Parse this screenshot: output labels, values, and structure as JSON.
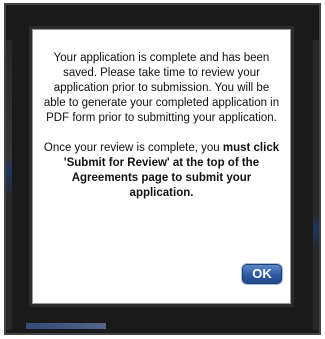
{
  "dialog": {
    "paragraph1": "Your application is complete and has been saved. Please take time to review your application prior to submission. You will be able to generate your completed application in PDF form prior to submitting your application.",
    "paragraph2_intro": "Once your review is complete, you",
    "paragraph2_bold": "must click 'Submit for Review' at the top of the Agreements page to submit your application.",
    "ok_label": "OK"
  },
  "colors": {
    "frame": "#1a1a1a",
    "button": "#2c5aa3"
  }
}
